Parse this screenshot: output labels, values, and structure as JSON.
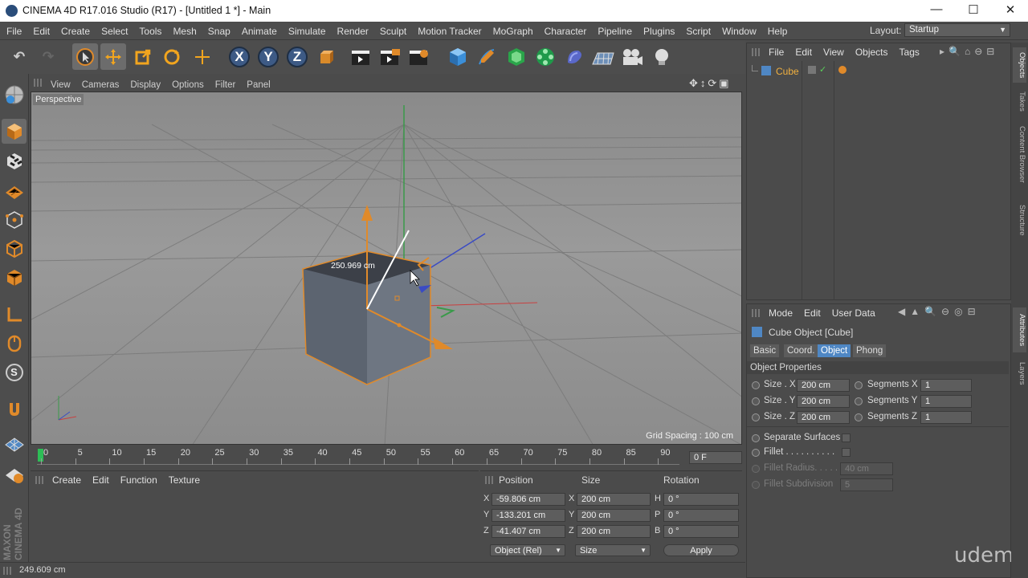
{
  "window": {
    "title": "CINEMA 4D R17.016 Studio (R17) - [Untitled 1 *] - Main",
    "minimize": "—",
    "maximize": "☐",
    "close": "✕"
  },
  "menubar": {
    "items": [
      "File",
      "Edit",
      "Create",
      "Select",
      "Tools",
      "Mesh",
      "Snap",
      "Animate",
      "Simulate",
      "Render",
      "Sculpt",
      "Motion Tracker",
      "MoGraph",
      "Character",
      "Pipeline",
      "Plugins",
      "Script",
      "Window",
      "Help"
    ],
    "layout_label": "Layout:",
    "layout_value": "Startup"
  },
  "toolbar": {
    "x_label": "X",
    "y_label": "Y",
    "z_label": "Z"
  },
  "leftbar": {
    "s_label": "S"
  },
  "viewport": {
    "menu": [
      "View",
      "Cameras",
      "Display",
      "Options",
      "Filter",
      "Panel"
    ],
    "name": "Perspective",
    "measure": "250.969 cm",
    "grid_spacing": "Grid Spacing : 100 cm"
  },
  "timeline": {
    "ticks": [
      "0",
      "5",
      "10",
      "15",
      "20",
      "25",
      "30",
      "35",
      "40",
      "45",
      "50",
      "55",
      "60",
      "65",
      "70",
      "75",
      "80",
      "85",
      "90"
    ],
    "current_frame": "0 F"
  },
  "material_manager": {
    "menu": [
      "Create",
      "Edit",
      "Function",
      "Texture"
    ]
  },
  "coordinates": {
    "headers": {
      "position": "Position",
      "size": "Size",
      "rotation": "Rotation"
    },
    "rows": [
      {
        "axis": "X",
        "pos": "-59.806 cm",
        "saxis": "X",
        "size": "200 cm",
        "raxis": "H",
        "rot": "0 °"
      },
      {
        "axis": "Y",
        "pos": "-133.201 cm",
        "saxis": "Y",
        "size": "200 cm",
        "raxis": "P",
        "rot": "0 °"
      },
      {
        "axis": "Z",
        "pos": "-41.407 cm",
        "saxis": "Z",
        "size": "200 cm",
        "raxis": "B",
        "rot": "0 °"
      }
    ],
    "mode": "Object (Rel)",
    "size_mode": "Size",
    "apply": "Apply"
  },
  "status": {
    "text": "249.609 cm"
  },
  "object_manager": {
    "menu": [
      "File",
      "Edit",
      "View",
      "Objects",
      "Tags"
    ],
    "object_name": "Cube"
  },
  "attributes": {
    "menu": [
      "Mode",
      "Edit",
      "User Data"
    ],
    "object_title": "Cube Object [Cube]",
    "tabs": [
      "Basic",
      "Coord.",
      "Object",
      "Phong"
    ],
    "section": "Object Properties",
    "size_x_label": "Size . X",
    "size_x": "200 cm",
    "size_y_label": "Size . Y",
    "size_y": "200 cm",
    "size_z_label": "Size . Z",
    "size_z": "200 cm",
    "seg_x_label": "Segments X",
    "seg_x": "1",
    "seg_y_label": "Segments Y",
    "seg_y": "1",
    "seg_z_label": "Segments Z",
    "seg_z": "1",
    "separate_surfaces": "Separate Surfaces",
    "fillet": "Fillet . . . . . . . . . .",
    "fillet_radius_label": "Fillet Radius. . . . .",
    "fillet_radius": "40 cm",
    "fillet_subdiv_label": "Fillet Subdivision",
    "fillet_subdiv": "5"
  },
  "side_tabs": [
    "Objects",
    "Takes",
    "Content Browser",
    "Structure",
    "Attributes",
    "Layers"
  ],
  "watermark": "udemy",
  "brand": "MAXON CINEMA 4D",
  "colors": {
    "accent": "#4f87c4",
    "selection": "#e09a3c",
    "panel": "#4b4b4b"
  }
}
